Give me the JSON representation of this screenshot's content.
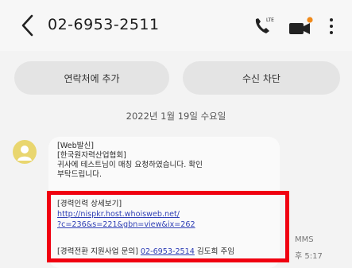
{
  "header": {
    "phone_number": "02-6953-2511"
  },
  "actions": {
    "add_contact": "연락처에 추가",
    "block": "수신 차단"
  },
  "date_divider": "2022년 1월 19일 수요일",
  "message": {
    "line1": "[Web발신]",
    "line2": "[한국원자력산업협회]",
    "line3": "귀사에 테스트님이 매칭 요청하였습니다. 확인",
    "line4": "부탁드립니다.",
    "line5": "[경력인력 상세보기]",
    "link_line1": "http://nispkr.host.whoisweb.net/",
    "link_line2": "?c=236&s=221&gbn=view&ix=262",
    "contact_prefix": "[경력전환 지원사업 문의] ",
    "contact_phone": "02-6953-2514",
    "contact_suffix": " 김도희 주임"
  },
  "meta": {
    "type_label": "MMS",
    "time_label": "후 5:17"
  },
  "colors": {
    "highlight": "#f00010",
    "link": "#2f3fb5",
    "avatar": "#e9d66f"
  },
  "icons": [
    "back-arrow-icon",
    "phone-call-icon",
    "video-call-icon",
    "more-options-icon",
    "person-icon"
  ]
}
